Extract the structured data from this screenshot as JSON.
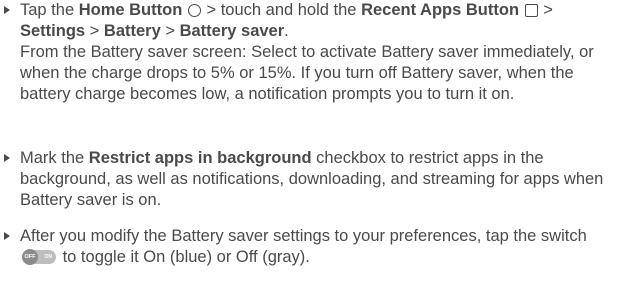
{
  "bullets": [
    {
      "line1_pre": "Tap the ",
      "home_label": "Home Button",
      "mid1": " > touch and hold the ",
      "recent_label": "Recent Apps Button",
      "mid2": " >",
      "settings_label": "Settings",
      "sep1": " > ",
      "battery_label": "Battery",
      "sep2": " > ",
      "saver_label": "Battery saver",
      "end": ".",
      "paragraph": "From the Battery saver screen: Select to activate Battery saver immediately, or when the charge drops to 5% or 15%. If you turn off Battery saver, when the battery charge becomes low, a notification prompts you to turn it on."
    },
    {
      "pre": "Mark the ",
      "bold": "Restrict apps in background",
      "post": " checkbox to restrict apps in the background, as well as notifications, downloading, and streaming for apps when Battery saver is on."
    },
    {
      "pre": "After you modify the Battery saver settings to your preferences, tap the switch ",
      "switch_off_text": "OFF",
      "switch_on_text": "ON",
      "post": " to toggle it On (blue) or Off (gray)."
    }
  ],
  "icons": {
    "home": "circle-outline-icon",
    "recent": "square-outline-icon",
    "switch": "toggle-switch-icon",
    "bullet": "triangle-bullet-icon"
  },
  "colors": {
    "text": "#4a4a4a",
    "switch_track": "#bdbdbd",
    "switch_knob": "#8c8c8c"
  }
}
